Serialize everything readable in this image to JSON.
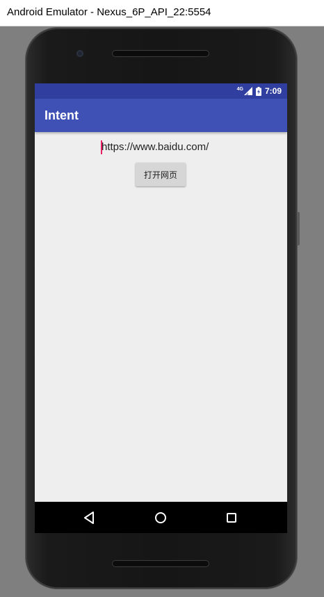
{
  "window": {
    "title": "Android Emulator - Nexus_6P_API_22:5554"
  },
  "status_bar": {
    "network_label": "4G",
    "time": "7:09"
  },
  "app_bar": {
    "title": "Intent"
  },
  "main": {
    "url_field": {
      "value": "https://www.baidu.com/"
    },
    "open_button": {
      "label": "打开网页"
    }
  },
  "nav_bar": {
    "buttons": [
      "back-icon",
      "home-icon",
      "recents-icon"
    ]
  },
  "colors": {
    "status_bar": "#303f9f",
    "app_bar": "#3f51b5",
    "screen_background": "#eeeeee",
    "cursor": "#e91e63"
  }
}
